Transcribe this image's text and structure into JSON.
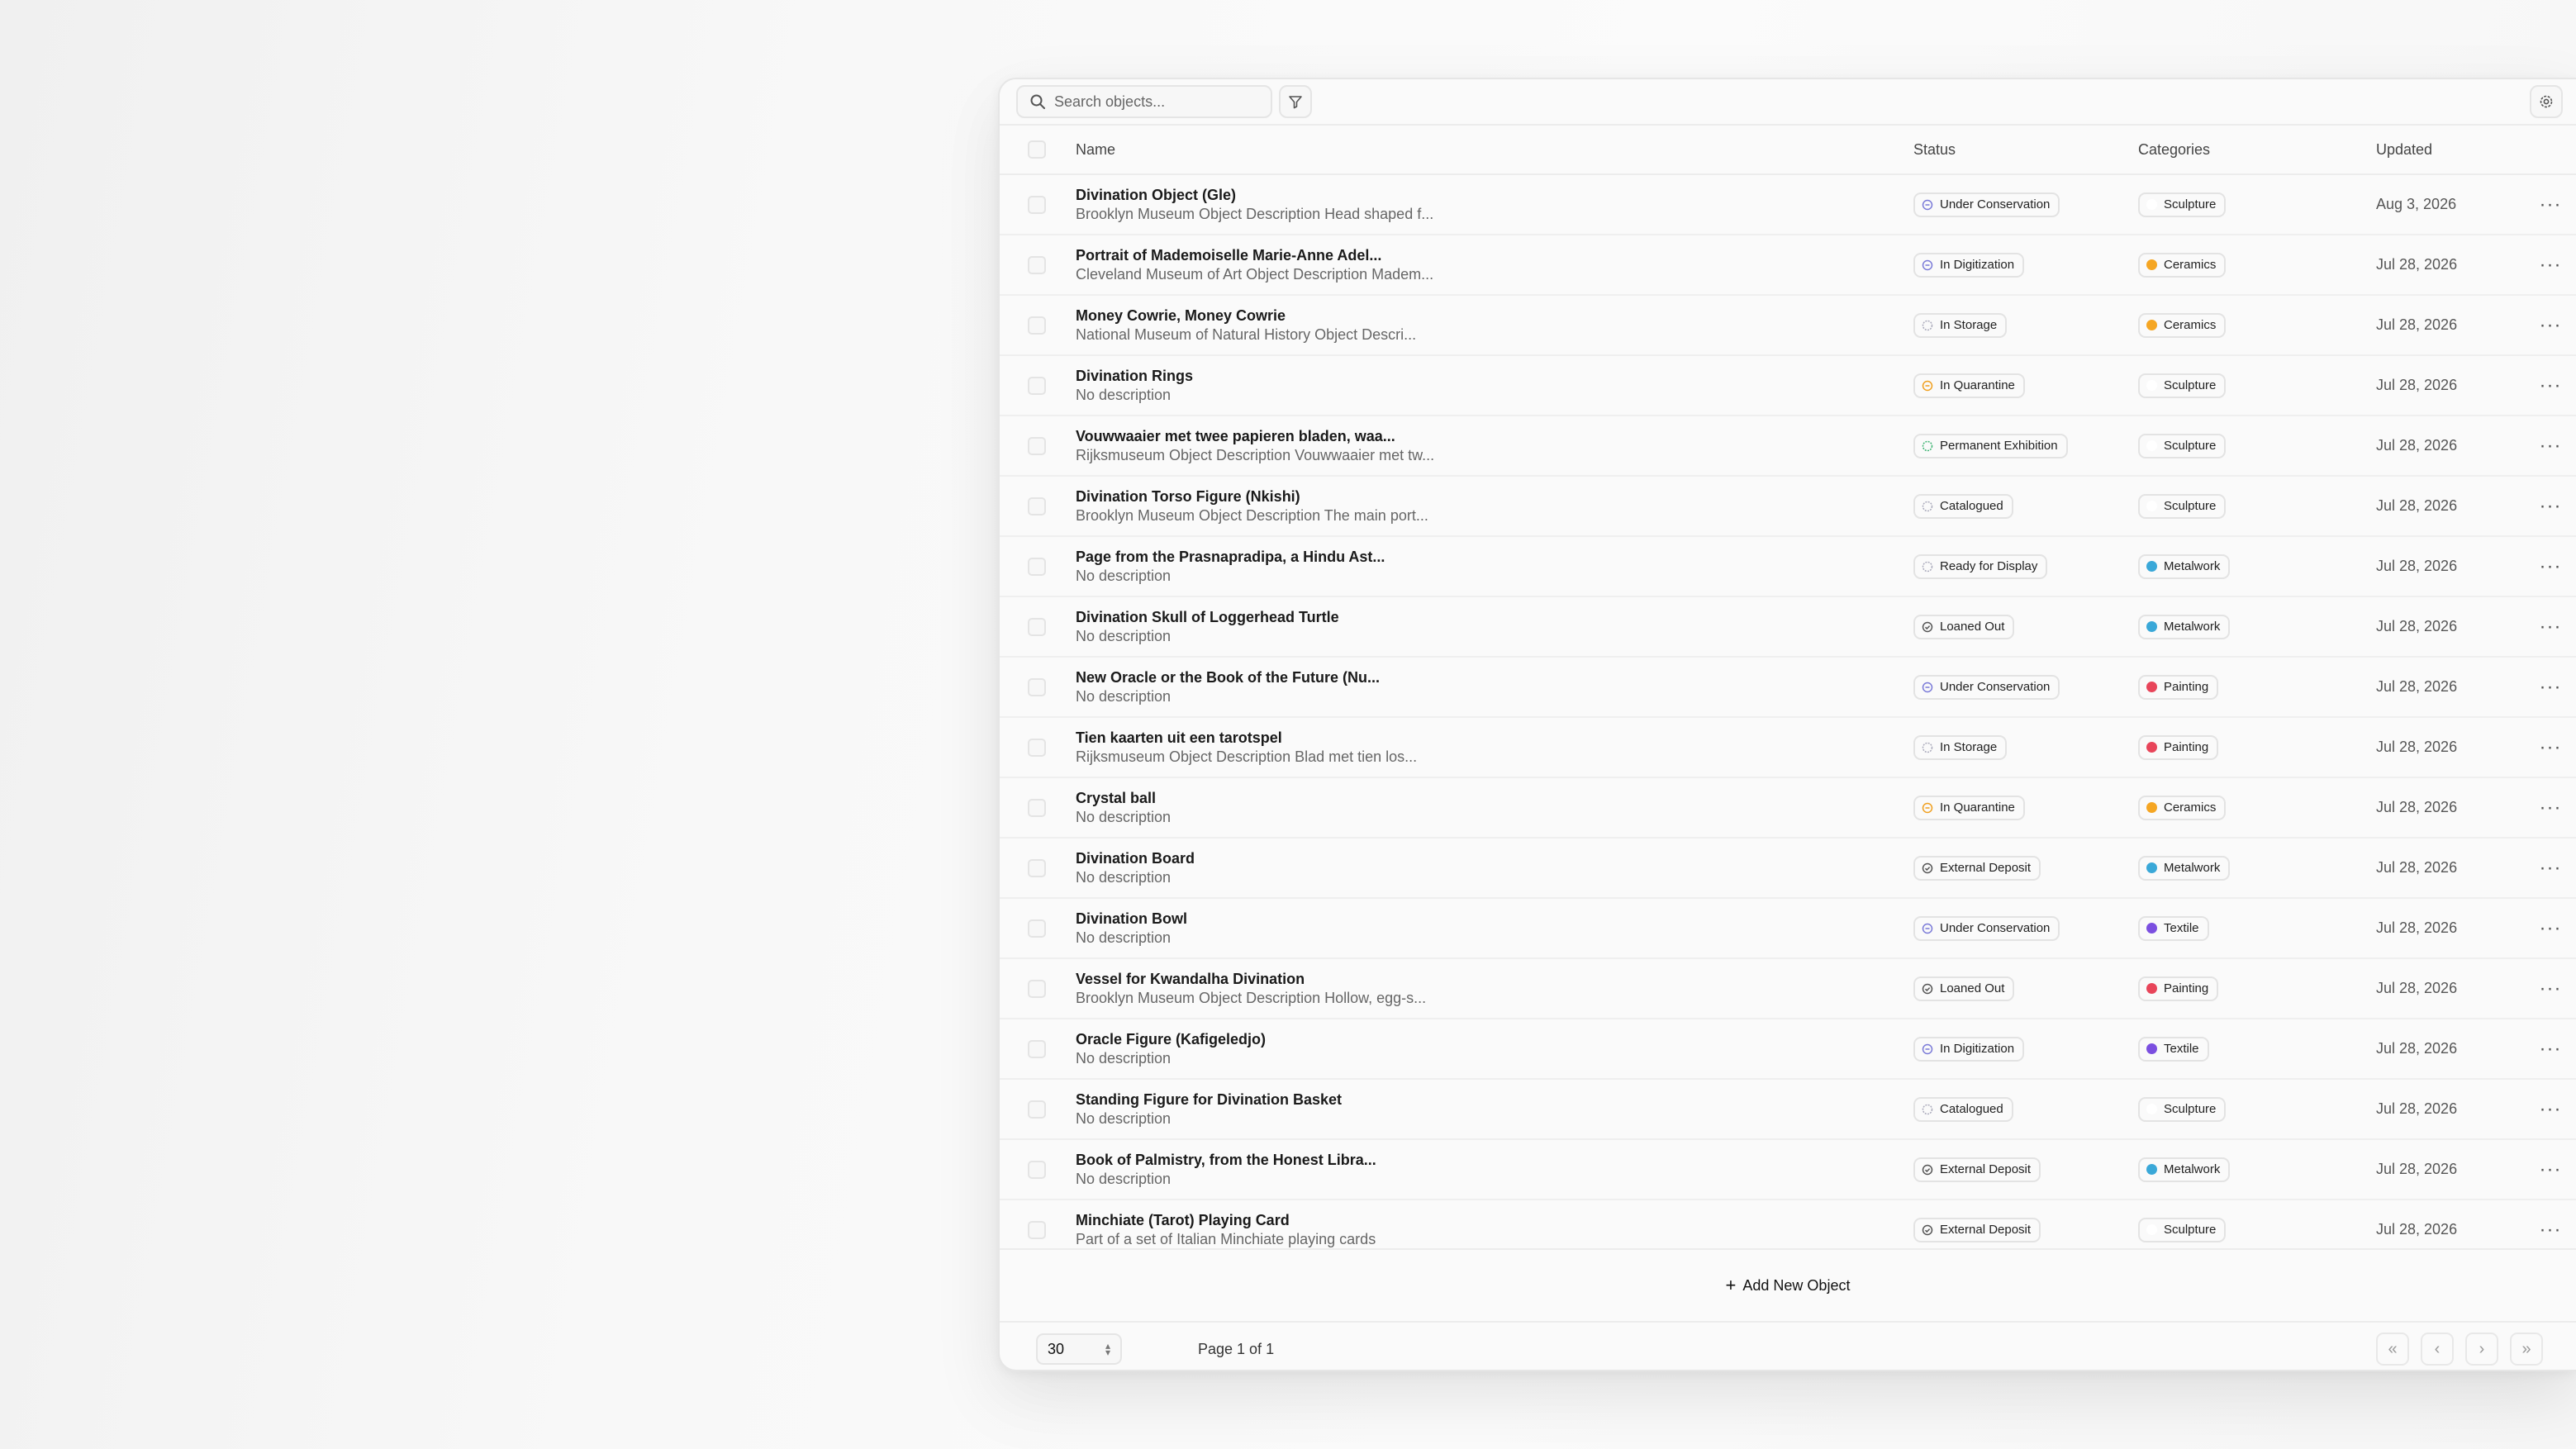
{
  "search": {
    "placeholder": "Search objects..."
  },
  "columns": {
    "name": "Name",
    "status": "Status",
    "categories": "Categories",
    "updated": "Updated"
  },
  "colors": {
    "Ceramics": "#f5a623",
    "Metalwork": "#3aa8d8",
    "Painting": "#e8455a",
    "Textile": "#7b4fe0",
    "Sculpture": "#ffffff"
  },
  "status_icons": {
    "Under Conservation": "circle-minus-icon",
    "In Digitization": "circle-minus-icon",
    "In Storage": "circle-dashed-icon",
    "In Quarantine": "circle-minus-icon",
    "Permanent Exhibition": "circle-dashed-icon",
    "Catalogued": "circle-dashed-icon",
    "Ready for Display": "circle-dashed-icon",
    "Loaned Out": "circle-check-icon",
    "External Deposit": "circle-check-icon"
  },
  "rows": [
    {
      "title": "Divination Object (Gle)",
      "desc": "Brooklyn Museum Object Description Head shaped f...",
      "status": "Under Conservation",
      "category": "Sculpture",
      "updated": "Aug 3, 2026"
    },
    {
      "title": "Portrait of Mademoiselle Marie-Anne Adel...",
      "desc": "Cleveland Museum of Art Object Description Madem...",
      "status": "In Digitization",
      "category": "Ceramics",
      "updated": "Jul 28, 2026"
    },
    {
      "title": "Money Cowrie, Money Cowrie",
      "desc": "National Museum of Natural History Object Descri...",
      "status": "In Storage",
      "category": "Ceramics",
      "updated": "Jul 28, 2026"
    },
    {
      "title": "Divination Rings",
      "desc": "No description",
      "status": "In Quarantine",
      "category": "Sculpture",
      "updated": "Jul 28, 2026"
    },
    {
      "title": "Vouwwaaier met twee papieren bladen, waa...",
      "desc": "Rijksmuseum Object Description Vouwwaaier met tw...",
      "status": "Permanent Exhibition",
      "category": "Sculpture",
      "updated": "Jul 28, 2026"
    },
    {
      "title": "Divination Torso Figure (Nkishi)",
      "desc": "Brooklyn Museum Object Description The main port...",
      "status": "Catalogued",
      "category": "Sculpture",
      "updated": "Jul 28, 2026"
    },
    {
      "title": "Page from the Prasnapradipa, a Hindu Ast...",
      "desc": "No description",
      "status": "Ready for Display",
      "category": "Metalwork",
      "updated": "Jul 28, 2026"
    },
    {
      "title": "Divination Skull of Loggerhead Turtle",
      "desc": "No description",
      "status": "Loaned Out",
      "category": "Metalwork",
      "updated": "Jul 28, 2026"
    },
    {
      "title": "New Oracle or the Book of the Future (Nu...",
      "desc": "No description",
      "status": "Under Conservation",
      "category": "Painting",
      "updated": "Jul 28, 2026"
    },
    {
      "title": "Tien kaarten uit een tarotspel",
      "desc": "Rijksmuseum Object Description Blad met tien los...",
      "status": "In Storage",
      "category": "Painting",
      "updated": "Jul 28, 2026"
    },
    {
      "title": "Crystal ball",
      "desc": "No description",
      "status": "In Quarantine",
      "category": "Ceramics",
      "updated": "Jul 28, 2026"
    },
    {
      "title": "Divination Board",
      "desc": "No description",
      "status": "External Deposit",
      "category": "Metalwork",
      "updated": "Jul 28, 2026"
    },
    {
      "title": "Divination Bowl",
      "desc": "No description",
      "status": "Under Conservation",
      "category": "Textile",
      "updated": "Jul 28, 2026"
    },
    {
      "title": "Vessel for Kwandalha Divination",
      "desc": "Brooklyn Museum Object Description Hollow, egg-s...",
      "status": "Loaned Out",
      "category": "Painting",
      "updated": "Jul 28, 2026"
    },
    {
      "title": "Oracle Figure (Kafigeledjo)",
      "desc": "No description",
      "status": "In Digitization",
      "category": "Textile",
      "updated": "Jul 28, 2026"
    },
    {
      "title": "Standing Figure for Divination Basket",
      "desc": "No description",
      "status": "Catalogued",
      "category": "Sculpture",
      "updated": "Jul 28, 2026"
    },
    {
      "title": "Book of Palmistry, from the Honest Libra...",
      "desc": "No description",
      "status": "External Deposit",
      "category": "Metalwork",
      "updated": "Jul 28, 2026"
    },
    {
      "title": "Minchiate (Tarot) Playing Card",
      "desc": "Part of a set of Italian Minchiate playing cards",
      "status": "External Deposit",
      "category": "Sculpture",
      "updated": "Jul 28, 2026"
    }
  ],
  "actions": {
    "add_label": "Add New Object"
  },
  "footer": {
    "page_size": "30",
    "page_label": "Page 1 of 1"
  }
}
